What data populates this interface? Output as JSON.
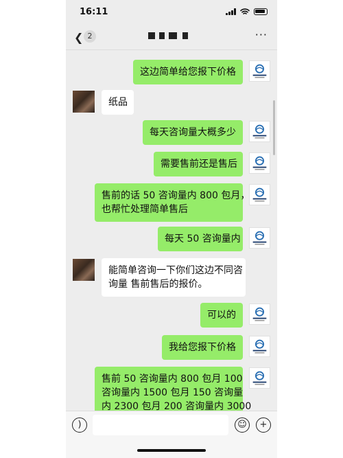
{
  "status": {
    "time": "16:11"
  },
  "nav": {
    "back_badge": "2",
    "more": "···"
  },
  "messages": [
    {
      "from": "me",
      "lines": [
        "这边简单给您报下价格"
      ]
    },
    {
      "from": "them",
      "lines": [
        "纸品"
      ]
    },
    {
      "from": "me",
      "lines": [
        "每天咨询量大概多少"
      ]
    },
    {
      "from": "me",
      "lines": [
        "需要售前还是售后"
      ]
    },
    {
      "from": "me",
      "lines": [
        "售前的话 50 咨询量内 800 包月，",
        "也帮忙处理简单售后"
      ]
    },
    {
      "from": "me",
      "lines": [
        "每天 50 咨询量内"
      ]
    },
    {
      "from": "them",
      "lines": [
        "能简单咨询一下你们这边不同咨",
        "询量 售前售后的报价。"
      ]
    },
    {
      "from": "me",
      "lines": [
        "可以的"
      ]
    },
    {
      "from": "me",
      "lines": [
        "我给您报下价格"
      ]
    },
    {
      "from": "me",
      "lines": [
        "售前 50 咨询量内 800 包月 100",
        "咨询量内 1500 包月 150 咨询量",
        "内 2300 包月 200 咨询量内 3000"
      ]
    }
  ],
  "inputbar": {
    "voice_icon": "voice-icon",
    "emoji_icon": "emoji-icon",
    "plus_icon": "plus-icon"
  },
  "colors": {
    "me_bubble": "#95ec69",
    "them_bubble": "#ffffff",
    "background": "#ededed"
  }
}
